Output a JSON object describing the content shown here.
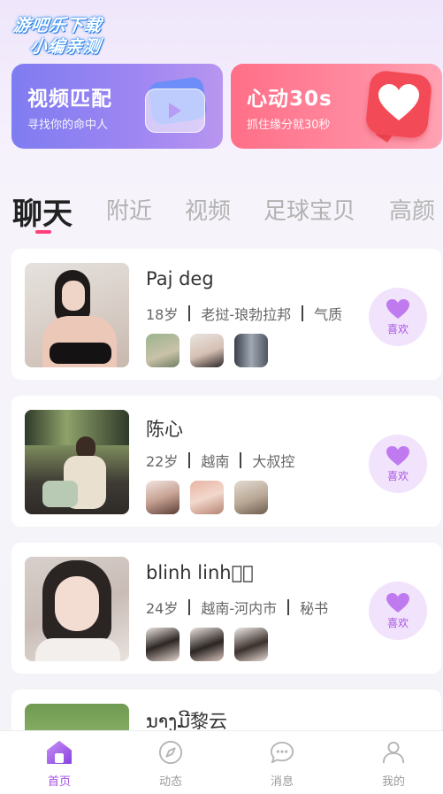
{
  "logo": {
    "line1": "游吧乐下载",
    "line2": "小编亲测"
  },
  "banners": [
    {
      "title": "视频匹配",
      "subtitle": "寻找你的命中人"
    },
    {
      "title": "心动30s",
      "subtitle": "抓住缘分就30秒"
    }
  ],
  "tabs": [
    "聊天",
    "附近",
    "视频",
    "足球宝贝",
    "高颜"
  ],
  "active_tab": "聊天",
  "like_label": "喜欢",
  "users": [
    {
      "name": "Paj deg",
      "age": "18岁",
      "location": "老挝-琅勃拉邦",
      "tag": "气质"
    },
    {
      "name": "陈心",
      "age": "22岁",
      "location": "越南",
      "tag": "大叔控"
    },
    {
      "name": "blinh linh\u0000\u0000",
      "age": "24岁",
      "location": "越南-河内市",
      "tag": "秘书"
    },
    {
      "name": "ນາງມີ黎云",
      "age": "",
      "location": "",
      "tag": ""
    }
  ],
  "bottom_nav": [
    {
      "label": "首页",
      "icon": "home-icon",
      "active": true
    },
    {
      "label": "动态",
      "icon": "compass-icon",
      "active": false
    },
    {
      "label": "消息",
      "icon": "chat-bubble-icon",
      "active": false
    },
    {
      "label": "我的",
      "icon": "person-icon",
      "active": false
    }
  ],
  "colors": {
    "accent": "#a64fe6",
    "tab_indicator": "#ff3f7a",
    "like_bg": "#f1e3fb",
    "banner_video": "#8a7ff2",
    "banner_heart": "#ff7b92"
  }
}
